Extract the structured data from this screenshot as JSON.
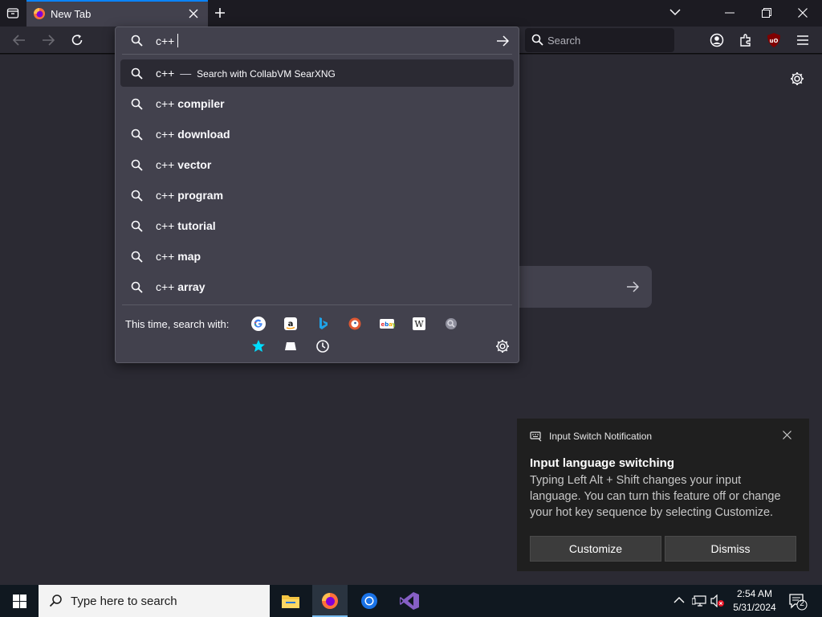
{
  "browser": {
    "tab_title": "New Tab",
    "search_placeholder": "Search",
    "urlbar": {
      "input_value": "c++",
      "selected_suggestion": {
        "query": "c++",
        "dash": "—",
        "action": "Search with CollabVM SearXNG"
      },
      "suggestions": [
        {
          "prefix": "c++ ",
          "bold": "compiler"
        },
        {
          "prefix": "c++ ",
          "bold": "download"
        },
        {
          "prefix": "c++ ",
          "bold": "vector"
        },
        {
          "prefix": "c++ ",
          "bold": "program"
        },
        {
          "prefix": "c++ ",
          "bold": "tutorial"
        },
        {
          "prefix": "c++ ",
          "bold": "map"
        },
        {
          "prefix": "c++ ",
          "bold": "array"
        }
      ],
      "oneoff_label": "This time, search with:",
      "engines": [
        "google-icon",
        "amazon-icon",
        "bing-icon",
        "duckduckgo-icon",
        "ebay-icon",
        "wikipedia-icon",
        "searxng-icon",
        "bookmarks-icon",
        "tabs-icon",
        "history-icon"
      ]
    }
  },
  "notification": {
    "header": "Input Switch Notification",
    "title": "Input language switching",
    "body": "Typing Left Alt + Shift changes your input language. You can turn this feature off or change your hot key sequence by selecting Customize.",
    "customize_label": "Customize",
    "dismiss_label": "Dismiss"
  },
  "taskbar": {
    "search_placeholder": "Type here to search",
    "time": "2:54 AM",
    "date": "5/31/2024",
    "notification_count": "2"
  },
  "colors": {
    "accent": "#0a84ff",
    "panel": "#42414d",
    "page": "#2b2a33"
  }
}
